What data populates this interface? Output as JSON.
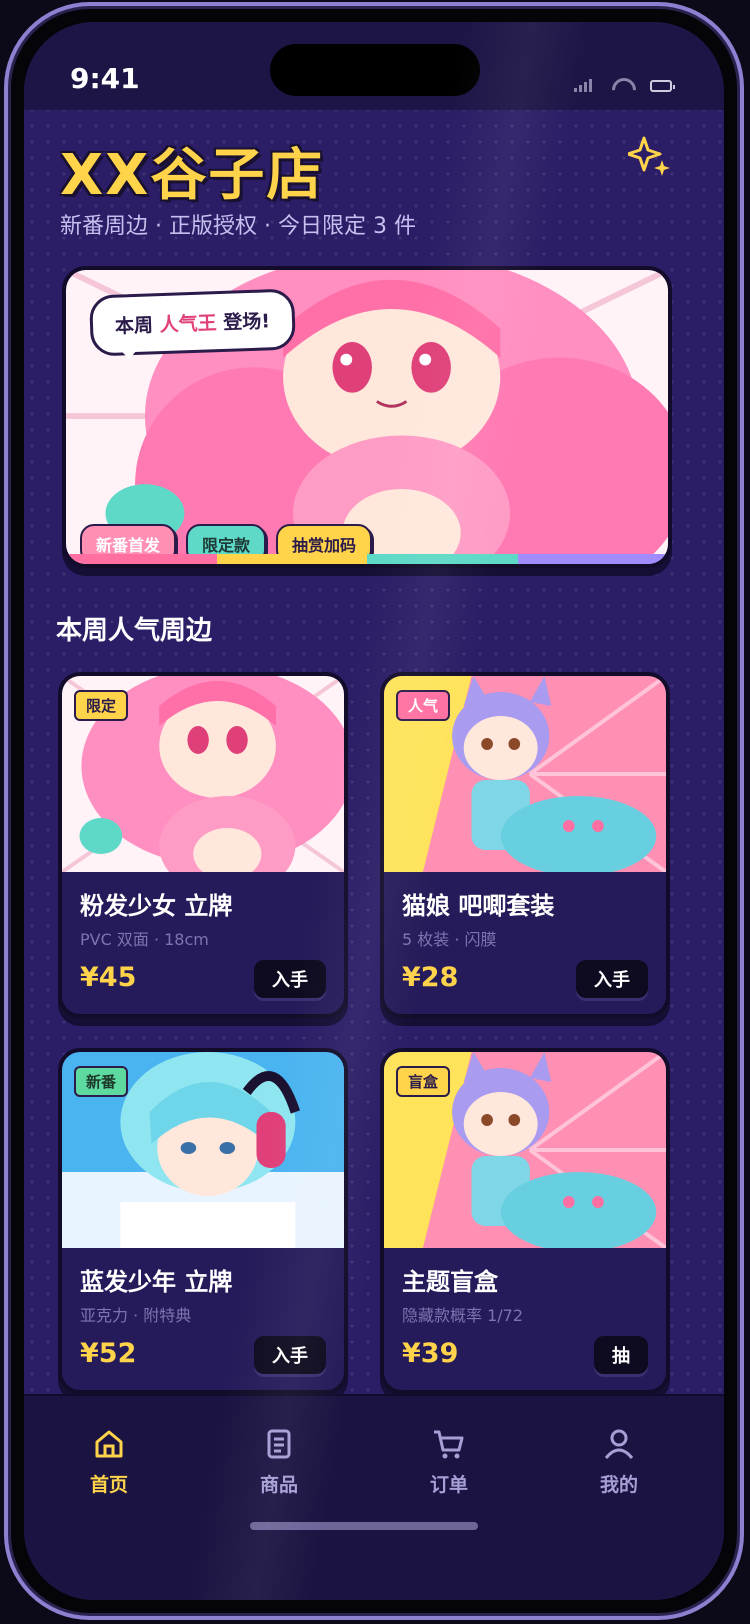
{
  "status_bar": {
    "time": "9:41"
  },
  "header": {
    "title": "XX谷子店",
    "subtitle": "新番周边 · 正版授权 · 今日限定 3 件"
  },
  "banner": {
    "bubble_prefix": "本周 ",
    "bubble_highlight": "人气王",
    "bubble_suffix": " 登场!",
    "chips": [
      {
        "label": "新番首发",
        "color": "#ff8fb3"
      },
      {
        "label": "限定款",
        "color": "#5ed9c7"
      },
      {
        "label": "抽赏加码",
        "color": "#ffd34a"
      }
    ],
    "stripe_colors": [
      "#ff6fa1",
      "#ffd34a",
      "#5ed9c7",
      "#a08bff"
    ]
  },
  "section": {
    "title": "本周人气周边"
  },
  "products": [
    {
      "tag": "限定",
      "tag_color": "#ffd34a",
      "name": "粉发少女 立牌",
      "spec": "PVC 双面 · 18cm",
      "price": "¥45",
      "action": "入手",
      "art": "pink-girl"
    },
    {
      "tag": "人气",
      "tag_color": "#ff6fa1",
      "name": "猫娘 吧唧套装",
      "spec": "5 枚装 · 闪膜",
      "price": "¥28",
      "action": "入手",
      "art": "cat-girl"
    },
    {
      "tag": "新番",
      "tag_color": "#5ed9a0",
      "name": "蓝发少年 立牌",
      "spec": "亚克力 · 附特典",
      "price": "¥52",
      "action": "入手",
      "art": "blue-boy"
    },
    {
      "tag": "盲盒",
      "tag_color": "#ffd34a",
      "name": "主题盲盒",
      "spec": "隐藏款概率 1/72",
      "price": "¥39",
      "action": "抽",
      "art": "cat-girl"
    }
  ],
  "tabbar": {
    "items": [
      {
        "label": "首页",
        "icon": "home-icon",
        "active": true
      },
      {
        "label": "商品",
        "icon": "list-icon",
        "active": false
      },
      {
        "label": "订单",
        "icon": "cart-icon",
        "active": false
      },
      {
        "label": "我的",
        "icon": "user-icon",
        "active": false
      }
    ],
    "active_color": "#ffd34a",
    "inactive_color": "#a69fd6"
  }
}
